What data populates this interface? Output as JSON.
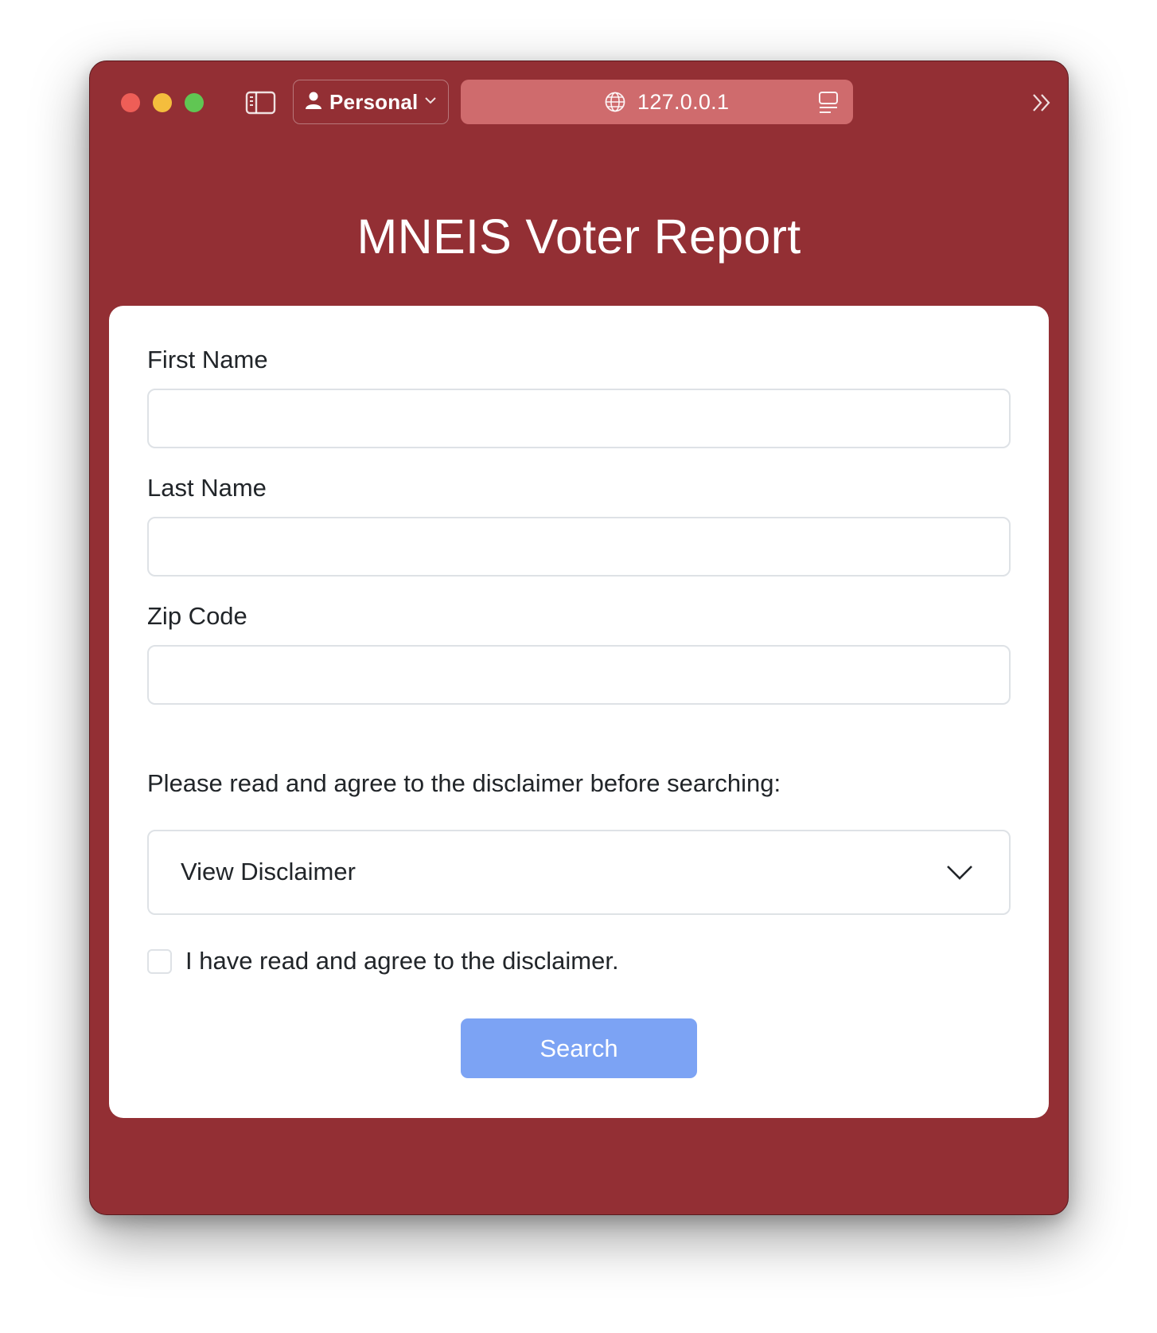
{
  "browser": {
    "profile_label": "Personal",
    "url": "127.0.0.1"
  },
  "page": {
    "title": "MNEIS Voter Report"
  },
  "form": {
    "first_name_label": "First Name",
    "first_name_value": "",
    "last_name_label": "Last Name",
    "last_name_value": "",
    "zip_label": "Zip Code",
    "zip_value": "",
    "disclaimer_prompt": "Please read and agree to the disclaimer before searching:",
    "disclaimer_toggle_label": "View Disclaimer",
    "agree_label": "I have read and agree to the disclaimer.",
    "agree_checked": false,
    "search_label": "Search"
  },
  "icons": {
    "sidebar": "sidebar-icon",
    "profile": "person-icon",
    "profile_chevron": "chevron-down-icon",
    "globe": "globe-icon",
    "reader": "reader-icon",
    "overflow": "double-chevron-right-icon",
    "disclaimer_chevron": "chevron-down-icon"
  },
  "colors": {
    "page_background": "#932f34",
    "address_bar": "#cf6b6d",
    "card": "#ffffff",
    "search_button": "#7ca3f4",
    "traffic_red": "#ee5e57",
    "traffic_yellow": "#f4bd3d",
    "traffic_green": "#60c653"
  }
}
